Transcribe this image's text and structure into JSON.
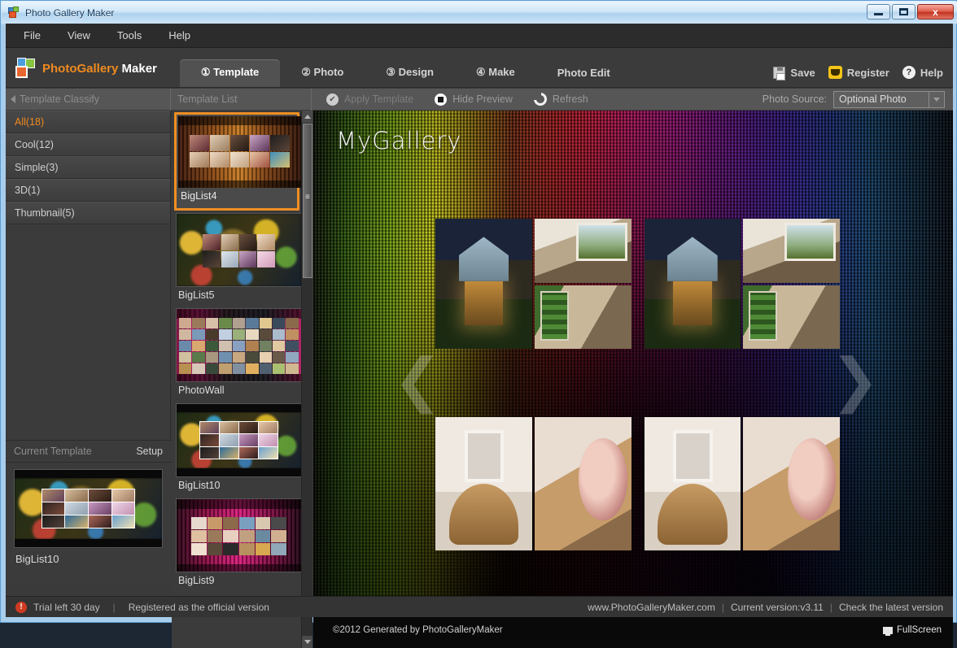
{
  "window": {
    "title": "Photo Gallery Maker",
    "controls": {
      "minimize": "–",
      "maximize": "□",
      "close": "x"
    }
  },
  "menubar": {
    "items": [
      "File",
      "View",
      "Tools",
      "Help"
    ]
  },
  "brand": {
    "part1": "PhotoGallery",
    "part2": " Maker"
  },
  "tabs": [
    {
      "label": "① Template",
      "active": true
    },
    {
      "label": "② Photo",
      "active": false
    },
    {
      "label": "③ Design",
      "active": false
    },
    {
      "label": "④ Make",
      "active": false
    },
    {
      "label": "Photo Edit",
      "active": false
    }
  ],
  "header_actions": {
    "save": "Save",
    "register": "Register",
    "help": "Help",
    "help_glyph": "?"
  },
  "subbar": {
    "classify_label": "Template Classify",
    "list_label": "Template List",
    "apply_template": "Apply Template",
    "apply_glyph": "✔",
    "hide_preview": "Hide Preview",
    "refresh": "Refresh",
    "photo_source_label": "Photo Source:",
    "photo_source_value": "Optional Photo",
    "photo_source_options": [
      "Optional Photo"
    ]
  },
  "classify": {
    "items": [
      {
        "label": "All(18)",
        "selected": true
      },
      {
        "label": "Cool(12)",
        "selected": false
      },
      {
        "label": "Simple(3)",
        "selected": false
      },
      {
        "label": "3D(1)",
        "selected": false
      },
      {
        "label": "Thumbnail(5)",
        "selected": false
      }
    ]
  },
  "current_template": {
    "header": "Current Template",
    "setup": "Setup",
    "name": "BigList10"
  },
  "template_list": {
    "items": [
      {
        "name": "BigList4",
        "active": true
      },
      {
        "name": "BigList5",
        "active": false
      },
      {
        "name": "PhotoWall",
        "active": false
      },
      {
        "name": "BigList10",
        "active": false
      },
      {
        "name": "BigList9",
        "active": false
      }
    ]
  },
  "preview": {
    "gallery_title": "MyGallery",
    "prev_arrow": "❮",
    "next_arrow": "❯",
    "copyright": "©2012 Generated by PhotoGalleryMaker",
    "fullscreen": "FullScreen"
  },
  "statusbar": {
    "warn_glyph": "!",
    "trial": "Trial left 30 day",
    "registered": "Registered as the official version",
    "website": "www.PhotoGalleryMaker.com",
    "version": "Current version:v3.11",
    "check_update": "Check the latest version",
    "sep": "|"
  },
  "colors": {
    "accent_orange": "#f08a1e",
    "selected_border": "#ef8e23",
    "panel_dark": "#3b3b3b",
    "toolbar_gray": "#565656"
  }
}
